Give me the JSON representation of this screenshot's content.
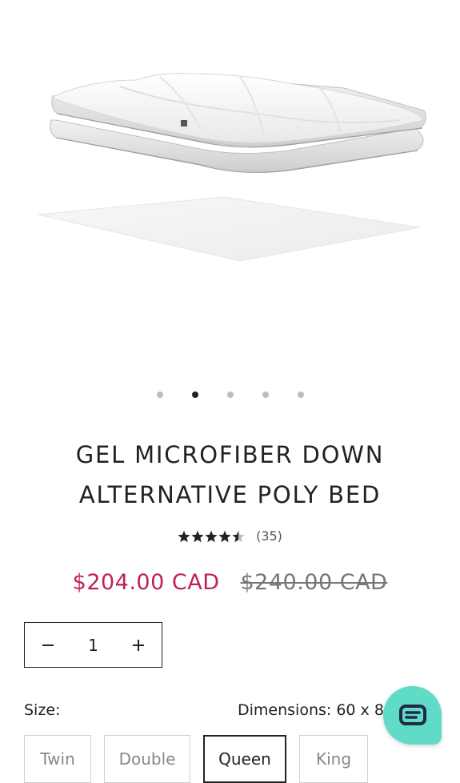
{
  "product": {
    "title_line1": "GEL MICROFIBER DOWN",
    "title_line2": "ALTERNATIVE POLY BED",
    "rating": 4.5,
    "rating_count": "(35)",
    "price_sale": "$204.00 CAD",
    "price_original": "$240.00 CAD"
  },
  "gallery": {
    "total_slides": 5,
    "active_index": 1
  },
  "quantity": {
    "value": "1",
    "decrement_icon": "minus-icon",
    "increment_icon": "plus-icon"
  },
  "options": {
    "size_label": "Size:",
    "dimensions_label": "Dimensions: 60 x 80",
    "sizes": [
      "Twin",
      "Double",
      "Queen",
      "King"
    ],
    "selected_size": "Queen"
  },
  "chat": {
    "icon": "chat-icon",
    "color": "#5fdbc8"
  },
  "colors": {
    "sale_price": "#c0205a",
    "text": "#222222"
  }
}
